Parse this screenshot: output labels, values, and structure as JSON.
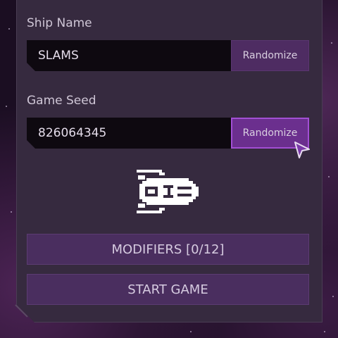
{
  "ship_name": {
    "label": "Ship Name",
    "value": "SLAMS",
    "randomize_label": "Randomize"
  },
  "game_seed": {
    "label": "Game Seed",
    "value": "826064345",
    "randomize_label": "Randomize"
  },
  "modifiers_button": "MODIFIERS [0/12]",
  "start_button": "START GAME",
  "colors": {
    "panel": "#362a3f",
    "field": "#0e0910",
    "button": "#4a2e5f",
    "button_active": "#6b2f8e",
    "accent": "#a24fd4",
    "text": "#d6cbe0"
  },
  "icons": {
    "ship": "pixel-spaceship-icon",
    "cursor": "pointer-cursor-icon"
  }
}
